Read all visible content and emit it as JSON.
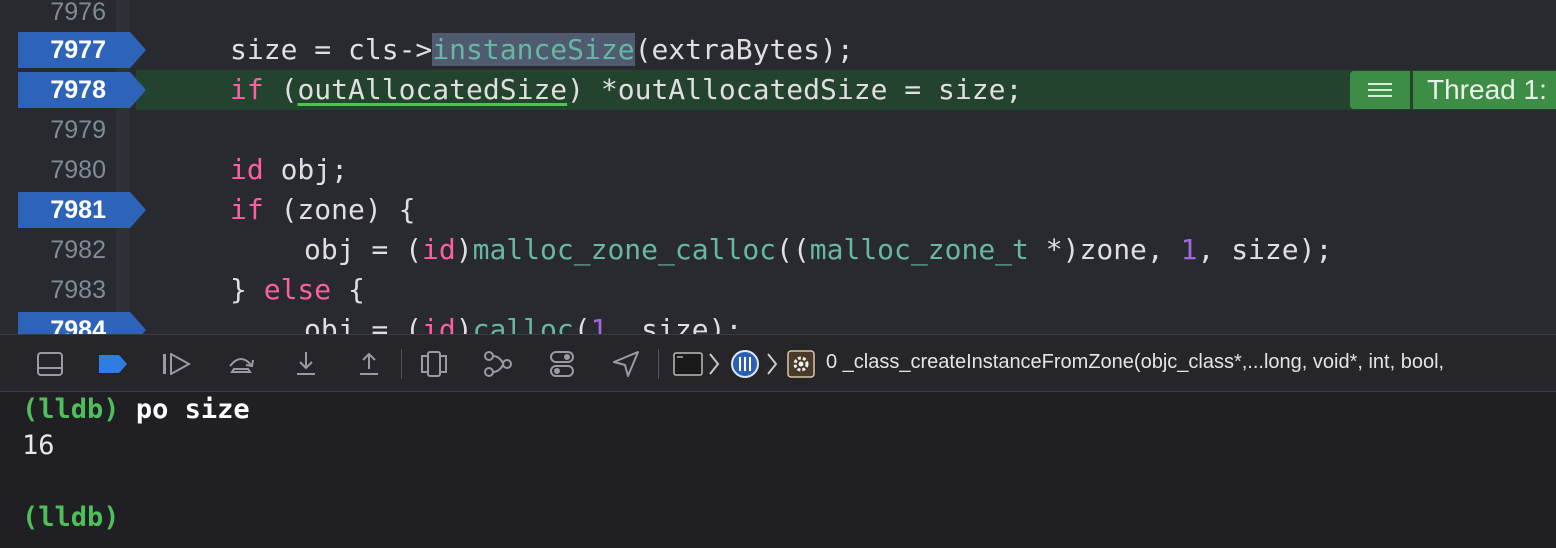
{
  "editor": {
    "lines": [
      {
        "num": "7976",
        "breakpoint": false
      },
      {
        "num": "7977",
        "breakpoint": true
      },
      {
        "num": "7978",
        "breakpoint": true
      },
      {
        "num": "7979",
        "breakpoint": false
      },
      {
        "num": "7980",
        "breakpoint": false
      },
      {
        "num": "7981",
        "breakpoint": true
      },
      {
        "num": "7982",
        "breakpoint": false
      },
      {
        "num": "7983",
        "breakpoint": false
      },
      {
        "num": "7984",
        "breakpoint": true
      }
    ],
    "code": {
      "l7977": {
        "a": "size = cls->",
        "b": "instanceSize",
        "c": "(extraBytes);"
      },
      "l7978": {
        "a": "if",
        "b": " (",
        "c": "outAllocatedSize",
        "d": ") *outAllocatedSize = size;"
      },
      "l7980": {
        "a": "id",
        "b": " obj;"
      },
      "l7981": {
        "a": "if",
        "b": " (zone) {"
      },
      "l7982": {
        "a": "obj = (",
        "b": "id",
        "c": ")",
        "d": "malloc_zone_calloc",
        "e": "((",
        "f": "malloc_zone_t",
        "g": " *)zone, ",
        "h": "1",
        "i": ", size);"
      },
      "l7983": {
        "a": "} ",
        "b": "else",
        "c": " {"
      },
      "l7984": {
        "a": "obj = (",
        "b": "id",
        "c": ")",
        "d": "calloc",
        "e": "(",
        "f": "1",
        "g": ", size);"
      }
    },
    "thread_badge": {
      "label": "Thread 1:"
    }
  },
  "debugbar": {
    "buttons": [
      "hide-debug-area",
      "breakpoints-toggle",
      "continue",
      "step-over",
      "step-into",
      "step-out",
      "view-hierarchy",
      "memory-graph",
      "environment-overrides",
      "simulate-location"
    ],
    "frame_text": "0 _class_createInstanceFromZone(objc_class*,...long, void*, int, bool,"
  },
  "console": {
    "prompt": "(lldb)",
    "command": "po size",
    "output": "16",
    "prompt2": "(lldb)"
  },
  "colors": {
    "breakpoint": "#2d63b8",
    "current_line": "#23432f",
    "thread_badge": "#3e8d47",
    "keyword": "#fc5fa3",
    "type": "#5dd8ff",
    "function": "#67b7a4",
    "prompt": "#4fbf5a"
  }
}
